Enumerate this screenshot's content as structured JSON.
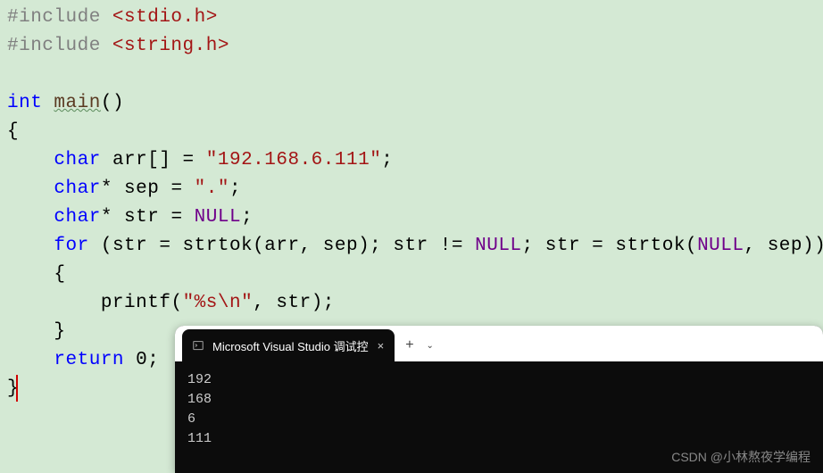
{
  "code": {
    "l1_pre": "#include ",
    "l1_path": "<stdio.h>",
    "l2_pre": "#include ",
    "l2_path": "<string.h>",
    "l4_type": "int",
    "l4_func": "main",
    "l4_parens": "()",
    "l5_brace": "{",
    "l6_indent": "    ",
    "l6_type": "char",
    "l6_rest1": " arr[] = ",
    "l6_str": "\"192.168.6.111\"",
    "l6_semi": ";",
    "l7_indent": "    ",
    "l7_type": "char",
    "l7_rest1": "* sep = ",
    "l7_str": "\".\"",
    "l7_semi": ";",
    "l8_indent": "    ",
    "l8_type": "char",
    "l8_rest1": "* str = ",
    "l8_null": "NULL",
    "l8_semi": ";",
    "l9_indent": "    ",
    "l9_for": "for",
    "l9_rest1": " (str = strtok(arr, sep); str != ",
    "l9_null": "NULL",
    "l9_rest2": "; str = strtok(",
    "l9_null2": "NULL",
    "l9_rest3": ", sep))",
    "l10": "    {",
    "l11_indent": "        ",
    "l11_func": "printf",
    "l11_open": "(",
    "l11_str": "\"%s\\n\"",
    "l11_rest": ", str);",
    "l12": "    }",
    "l13_indent": "    ",
    "l13_return": "return",
    "l13_rest": " 0;",
    "l14": "}"
  },
  "terminal": {
    "tab_title": "Microsoft Visual Studio 调试控",
    "tab_close": "×",
    "add": "+",
    "dropdown": "⌄",
    "output": [
      "192",
      "168",
      "6",
      "111"
    ]
  },
  "watermark": "CSDN @小林熬夜学编程"
}
